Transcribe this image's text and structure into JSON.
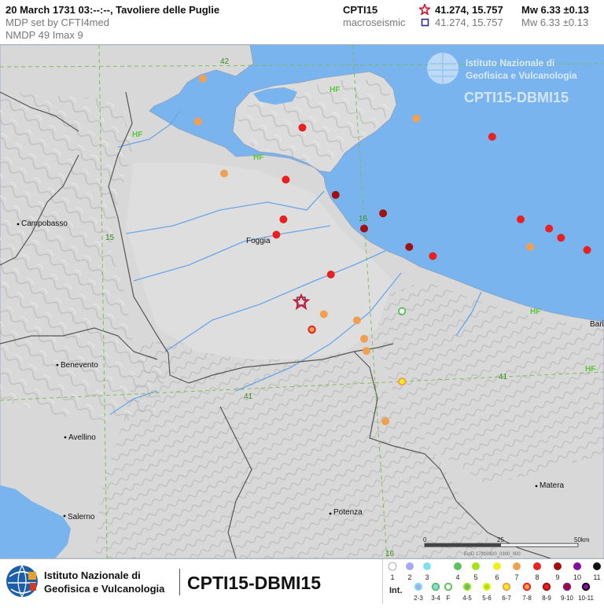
{
  "header": {
    "title": "20 March 1731  03:--:--,  Tavoliere delle Puglie",
    "mdp_set": "MDP set by CFTI4med",
    "stats": "NMDP 49    Imax 9",
    "catalogue": "CPTI15",
    "method": "macroseismic",
    "epicenter": "41.274, 15.757",
    "epicenter_macro": "41.274, 15.757",
    "magnitude": "Mw 6.33 ±0.13",
    "magnitude_macro": "Mw 6.33 ±0.13"
  },
  "watermark": {
    "institute_line1": "Istituto Nazionale di",
    "institute_line2": "Geofisica e Vulcanologia",
    "database": "CPTI15-DBMI15"
  },
  "map": {
    "cities": [
      {
        "name": "Campobasso"
      },
      {
        "name": "Foggia"
      },
      {
        "name": "Benevento"
      },
      {
        "name": "Avellino"
      },
      {
        "name": "Salerno"
      },
      {
        "name": "Potenza"
      },
      {
        "name": "Matera"
      },
      {
        "name": "Bari"
      }
    ],
    "graticule": {
      "lat_labels": [
        "42",
        "41"
      ],
      "lon_labels": [
        "15",
        "16"
      ]
    },
    "hf_label": "HF",
    "scale": {
      "start": "0",
      "mid": "25",
      "end": "50km"
    },
    "event_id": "EqID 17310320_0300_000"
  },
  "footer": {
    "institute_line1": "Istituto Nazionale di",
    "institute_line2": "Geofisica e Vulcanologia",
    "database": "CPTI15-DBMI15"
  },
  "legend": {
    "label": "Int.",
    "row1": [
      {
        "label": "1",
        "color": "#ffffff"
      },
      {
        "label": "2",
        "color": "#a8a8f0"
      },
      {
        "label": "3",
        "color": "#80e0f0"
      },
      {
        "label": "4",
        "color": "#60c060"
      },
      {
        "label": "5",
        "color": "#a8e020"
      },
      {
        "label": "6",
        "color": "#f0f020"
      },
      {
        "label": "7",
        "color": "#f0a050"
      },
      {
        "label": "8",
        "color": "#e82020"
      },
      {
        "label": "9",
        "color": "#a01010"
      },
      {
        "label": "10",
        "color": "#8010a0"
      },
      {
        "label": "11",
        "color": "#101010"
      }
    ],
    "row2": [
      {
        "label": "2-3",
        "color": "#a8a8f0"
      },
      {
        "label": "3-4",
        "color": "#80e0f0"
      },
      {
        "label": "F",
        "color": "#60c060"
      },
      {
        "label": "4-5",
        "color": "#a8e020"
      },
      {
        "label": "5-6",
        "color": "#f0f020"
      },
      {
        "label": "6-7",
        "color": "#f0a050"
      },
      {
        "label": "7-8",
        "color": "#e82020"
      },
      {
        "label": "8-9",
        "color": "#a01010"
      },
      {
        "label": "9-10",
        "color": "#8010a0"
      },
      {
        "label": "10-11",
        "color": "#101010"
      }
    ]
  },
  "colors": {
    "sea": "#7ab4ee",
    "land": "#d4d4d4",
    "grid": "#7ab94b",
    "hf": "#5cc63a",
    "epicenter_star": "#d4142a"
  },
  "observations": [
    {
      "lat": 41.84,
      "lon": 14.97,
      "intensity": "7"
    },
    {
      "lat": 41.7,
      "lon": 14.95,
      "intensity": "7"
    },
    {
      "lat": 41.68,
      "lon": 15.39,
      "intensity": "8"
    },
    {
      "lat": 41.71,
      "lon": 15.87,
      "intensity": "7"
    },
    {
      "lat": 41.65,
      "lon": 16.19,
      "intensity": "8"
    },
    {
      "lat": 41.53,
      "lon": 15.06,
      "intensity": "7"
    },
    {
      "lat": 41.51,
      "lon": 15.32,
      "intensity": "8"
    },
    {
      "lat": 41.46,
      "lon": 15.53,
      "intensity": "9"
    },
    {
      "lat": 41.4,
      "lon": 15.73,
      "intensity": "9"
    },
    {
      "lat": 41.38,
      "lon": 15.31,
      "intensity": "8"
    },
    {
      "lat": 41.35,
      "lon": 15.65,
      "intensity": "9"
    },
    {
      "lat": 41.29,
      "lon": 15.84,
      "intensity": "9"
    },
    {
      "lat": 41.33,
      "lon": 15.28,
      "intensity": "8"
    },
    {
      "lat": 41.26,
      "lon": 15.94,
      "intensity": "8"
    },
    {
      "lat": 41.2,
      "lon": 15.51,
      "intensity": "8"
    },
    {
      "lat": 41.38,
      "lon": 16.31,
      "intensity": "8"
    },
    {
      "lat": 41.35,
      "lon": 16.43,
      "intensity": "8"
    },
    {
      "lat": 41.32,
      "lon": 16.48,
      "intensity": "8"
    },
    {
      "lat": 41.28,
      "lon": 16.59,
      "intensity": "8"
    },
    {
      "lat": 41.29,
      "lon": 16.35,
      "intensity": "7"
    },
    {
      "lat": 41.12,
      "lon": 16.71,
      "intensity": "5"
    },
    {
      "lat": 41.12,
      "lon": 16.87,
      "intensity": "6-7"
    },
    {
      "lat": 41.07,
      "lon": 15.48,
      "intensity": "7"
    },
    {
      "lat": 41.05,
      "lon": 15.62,
      "intensity": "7"
    },
    {
      "lat": 41.08,
      "lon": 15.81,
      "intensity": "F"
    },
    {
      "lat": 41.02,
      "lon": 15.43,
      "intensity": "7-8"
    },
    {
      "lat": 40.99,
      "lon": 15.65,
      "intensity": "7"
    },
    {
      "lat": 40.95,
      "lon": 15.66,
      "intensity": "7"
    },
    {
      "lat": 40.85,
      "lon": 15.81,
      "intensity": "6-7"
    },
    {
      "lat": 41.07,
      "lon": 16.78,
      "intensity": "7"
    },
    {
      "lat": 40.98,
      "lon": 16.86,
      "intensity": "6-7"
    },
    {
      "lat": 40.72,
      "lon": 15.74,
      "intensity": "7"
    }
  ]
}
